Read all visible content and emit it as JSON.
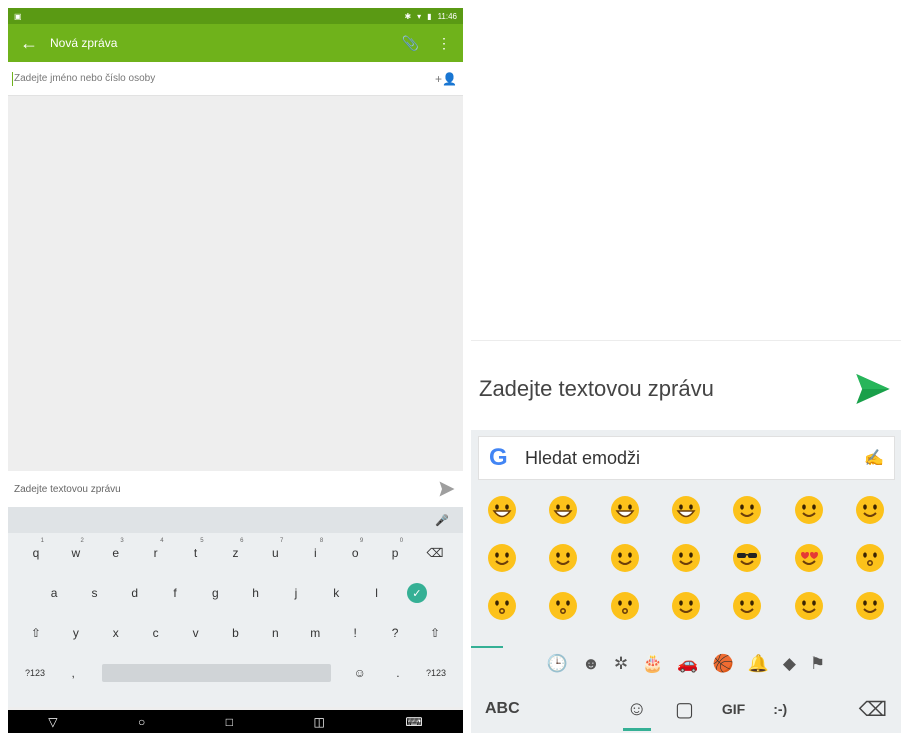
{
  "status_bar": {
    "time": "11:46"
  },
  "app_bar": {
    "title": "Nová zpráva",
    "back_icon": "←",
    "attach_icon": "📎",
    "menu_icon": "⋮"
  },
  "recipient": {
    "placeholder": "Zadejte jméno nebo číslo osoby",
    "add_person_icon": "+👤"
  },
  "compose_left": {
    "placeholder": "Zadejte textovou zprávu"
  },
  "keyboard": {
    "mic_icon": "🎤",
    "row1": [
      {
        "key": "q",
        "num": "1"
      },
      {
        "key": "w",
        "num": "2"
      },
      {
        "key": "e",
        "num": "3"
      },
      {
        "key": "r",
        "num": "4"
      },
      {
        "key": "t",
        "num": "5"
      },
      {
        "key": "z",
        "num": "6"
      },
      {
        "key": "u",
        "num": "7"
      },
      {
        "key": "i",
        "num": "8"
      },
      {
        "key": "o",
        "num": "9"
      },
      {
        "key": "p",
        "num": "0"
      }
    ],
    "backspace": "⌫",
    "row2": [
      "a",
      "s",
      "d",
      "f",
      "g",
      "h",
      "j",
      "k",
      "l"
    ],
    "done": "✓",
    "row3": [
      "y",
      "x",
      "c",
      "v",
      "b",
      "n",
      "m",
      "!",
      "?"
    ],
    "shift": "⇧",
    "sym_label": "?123",
    "comma": ",",
    "period": ".",
    "emoji_key": "☺"
  },
  "navbar": {
    "back": "▽",
    "home": "○",
    "recents": "□",
    "split": "◫",
    "keyboard": "⌨"
  },
  "compose_right": {
    "placeholder": "Zadejte textovou zprávu"
  },
  "emoji_keyboard": {
    "search_placeholder": "Hledat emodži",
    "google_letter": "G",
    "handwriting_icon": "✍",
    "categories": [
      "🕒",
      "☻",
      "✲",
      "🎂",
      "🚗",
      "🏀",
      "🔔",
      "◆",
      "⚑"
    ],
    "abc_label": "ABC",
    "emoji_tab": "☺",
    "sticker_tab": "▢",
    "gif_label": "GIF",
    "emoticon_label": ":-)",
    "delete_icon": "⌫"
  },
  "colors": {
    "appbar": "#6fb21b",
    "status": "#5a9a14",
    "accent": "#35b095",
    "send_green": "#19a04a",
    "emoji_yellow": "#fcc21b"
  }
}
